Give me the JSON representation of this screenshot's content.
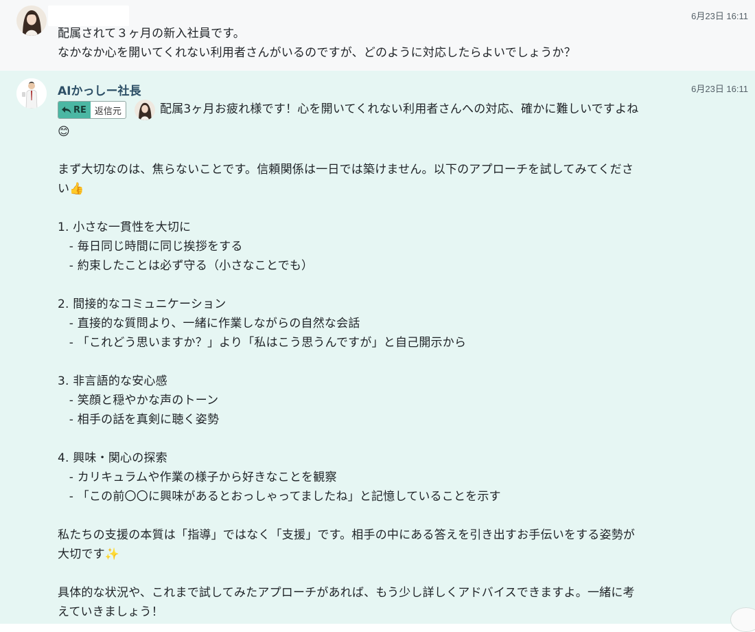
{
  "message1": {
    "time": "6月23日 16:11",
    "lines": [
      "配属されて３ヶ月の新入社員です。",
      "なかなか心を開いてくれない利用者さんがいるのですが、どのように対応したらよいでしょうか？"
    ]
  },
  "message2": {
    "sender": "AIかっしー社長",
    "time": "6月23日 16:11",
    "reply_button": {
      "tag": "RE",
      "label": "返信元"
    },
    "first_line": "配属3ヶ月お疲れ様です！心を開いてくれない利用者さんへの対応、確かに難しいですよね",
    "lines": [
      "😊",
      "まず大切なのは、焦らないことです。信頼関係は一日では築けません。以下のアプローチを試してみてくださ",
      "い👍",
      "1. 小さな一貫性を大切に",
      "   - 毎日同じ時間に同じ挨拶をする",
      "   - 約束したことは必ず守る（小さなことでも）",
      "2. 間接的なコミュニケーション",
      "   - 直接的な質問より、一緒に作業しながらの自然な会話",
      "   - 「これどう思いますか？」より「私はこう思うんですが」と自己開示から",
      "3. 非言語的な安心感",
      "   - 笑顔と穏やかな声のトーン",
      "   - 相手の話を真剣に聴く姿勢",
      "4. 興味・関心の探索",
      "   - カリキュラムや作業の様子から好きなことを観察",
      "   - 「この前〇〇に興味があるとおっしゃってましたね」と記憶していることを示す",
      "私たちの支援の本質は「指導」ではなく「支援」です。相手の中にある答えを引き出すお手伝いをする姿勢が",
      "大切です✨",
      "具体的な状況や、これまで試してみたアプローチがあれば、もう少し詳しくアドバイスできますよ。一緒に考",
      "えていきましょう！"
    ]
  },
  "icons": {
    "reply": "reply-arrow-icon",
    "user_avatar": "user-avatar",
    "bot_avatar": "bot-avatar"
  }
}
